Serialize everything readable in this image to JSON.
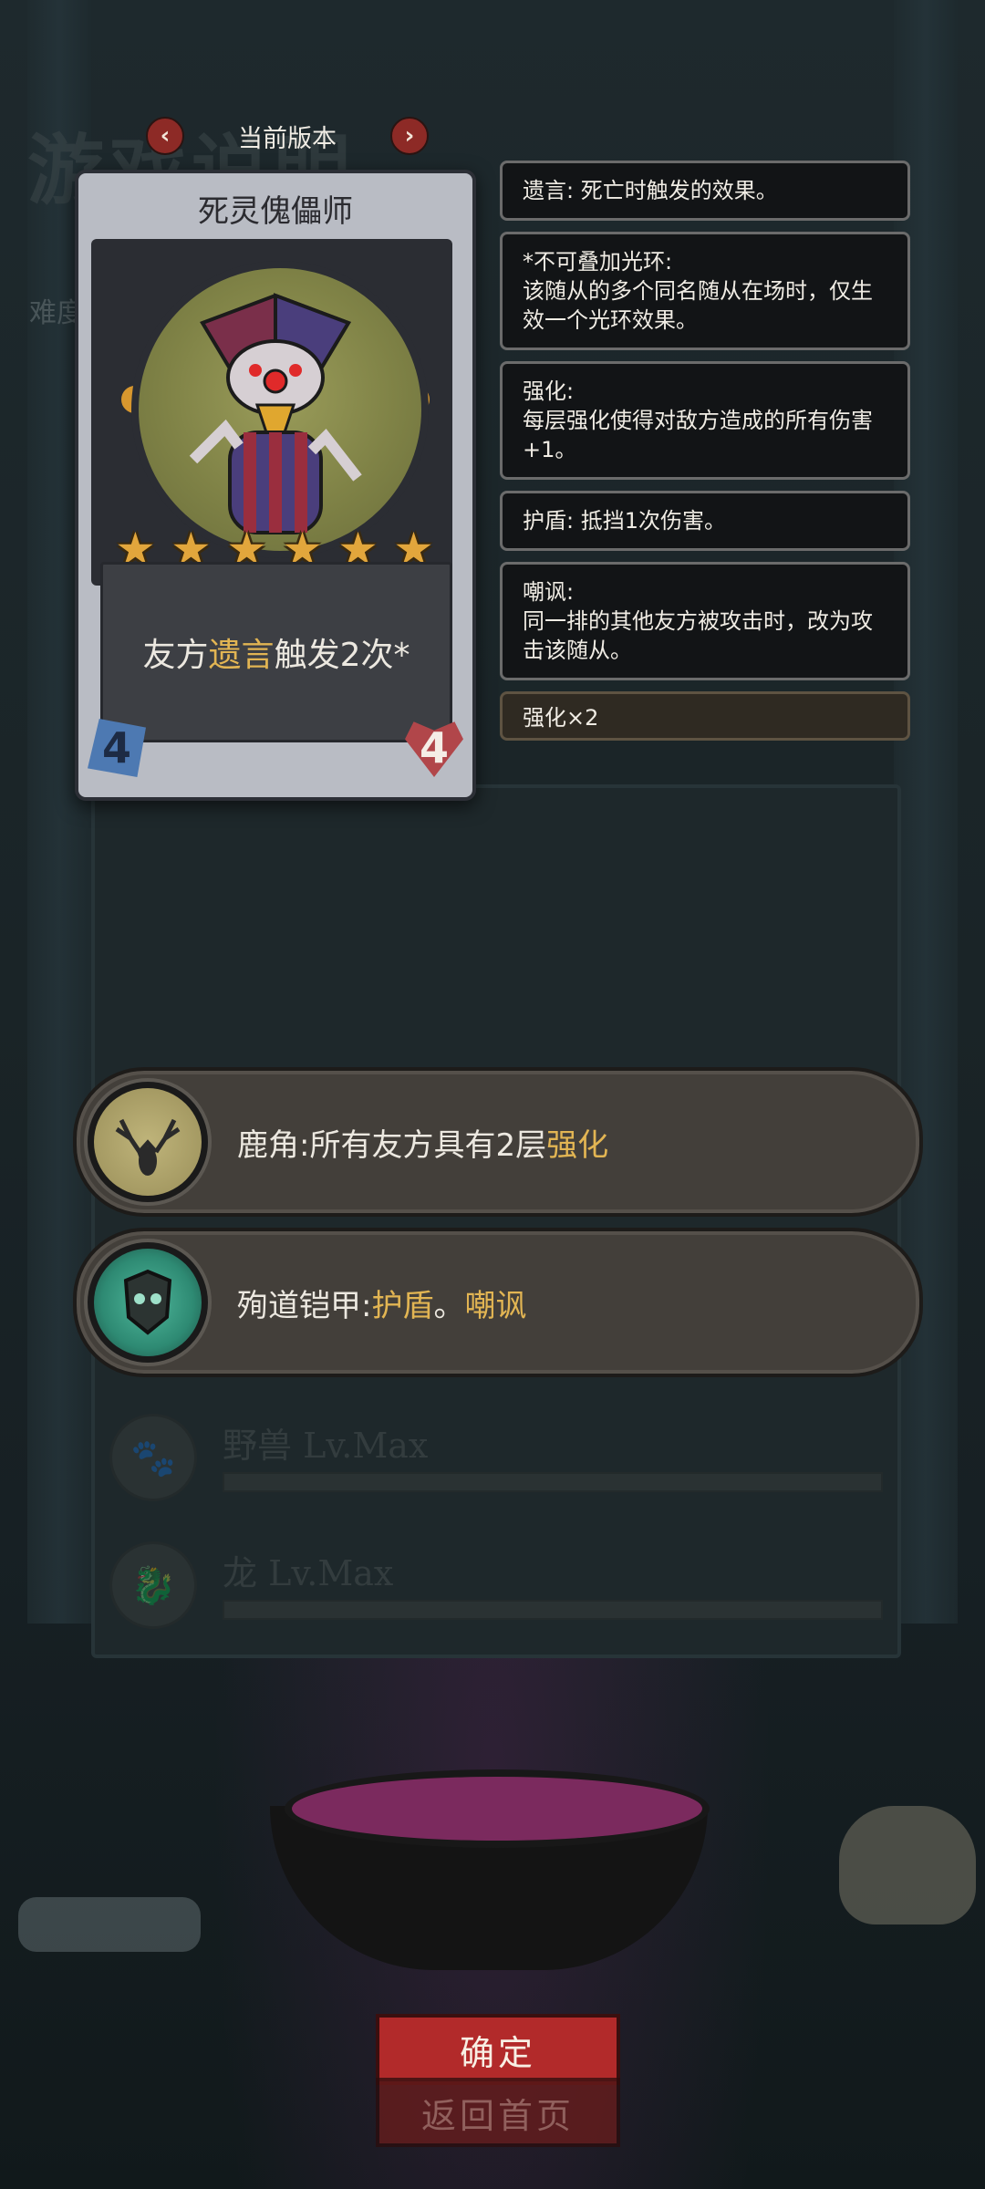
{
  "background": {
    "title": "游戏说明",
    "subtitle": "难度"
  },
  "version_bar": {
    "label": "当前版本",
    "prev_icon": "chevron-left-icon",
    "next_icon": "chevron-right-icon"
  },
  "card": {
    "name": "死灵傀儡师",
    "stars": 6,
    "description_prefix": "友方",
    "description_keyword": "遗言",
    "description_suffix": "触发2次*",
    "attack": "4",
    "health": "4",
    "colors": {
      "keyword": "#e2b553",
      "star": "#e2a63c"
    }
  },
  "tooltips": [
    {
      "title": "遗言: 死亡时触发的效果。",
      "body": ""
    },
    {
      "title": "*不可叠加光环:",
      "body": "该随从的多个同名随从在场时，仅生效一个光环效果。"
    },
    {
      "title": "强化:",
      "body": "每层强化使得对敌方造成的所有伤害+1。"
    },
    {
      "title": "护盾: 抵挡1次伤害。",
      "body": ""
    },
    {
      "title": "嘲讽:",
      "body": "同一排的其他友方被攻击时，改为攻击该随从。"
    },
    {
      "title": "强化×2",
      "body": ""
    }
  ],
  "relics": [
    {
      "prefix": "鹿角:所有友方具有2层",
      "keyword": "强化",
      "keyword2": "",
      "icon": "deer-antler-icon"
    },
    {
      "prefix": "殉道铠甲:",
      "keyword": "护盾",
      "sep": "。",
      "keyword2": "嘲讽",
      "icon": "martyr-armor-icon"
    }
  ],
  "levels": [
    {
      "name": "野兽 Lv.Max",
      "icon": "beast-icon"
    },
    {
      "name": "龙 Lv.Max",
      "icon": "dragon-icon"
    }
  ],
  "buttons": {
    "confirm": "确定",
    "home": "返回首页"
  }
}
